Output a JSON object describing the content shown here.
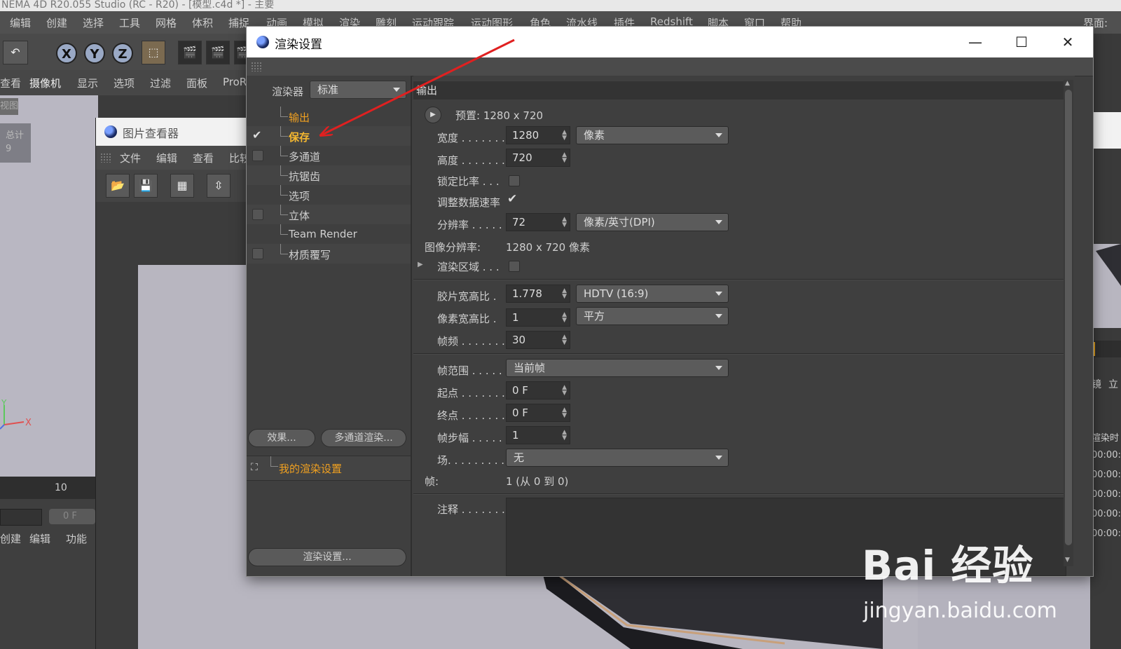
{
  "app": {
    "title": "NEMA 4D R20.055 Studio (RC - R20) - [模型.c4d *] - 主要",
    "menu": [
      "编辑",
      "创建",
      "选择",
      "工具",
      "网格",
      "体积",
      "捕捉",
      "动画",
      "模拟",
      "渲染",
      "雕刻",
      "运动跟踪",
      "运动图形",
      "角色",
      "流水线",
      "插件",
      "Redshift",
      "脚本",
      "窗口",
      "帮助"
    ],
    "interface_label": "界面:",
    "axis_buttons": [
      "X",
      "Y",
      "Z"
    ],
    "viewport_menu": [
      "查看",
      "摄像机",
      "显示",
      "选项",
      "过滤",
      "面板",
      "ProR"
    ],
    "view_tab": "视图",
    "total_label": "总计",
    "total_value": "9",
    "axis_y": "Y",
    "axis_x": "X",
    "timeline_tick": "10",
    "frame_field": "0 F",
    "bottom_menu": [
      "创建",
      "编辑",
      "功能"
    ]
  },
  "picture_viewer": {
    "title": "图片查看器",
    "menu": [
      "文件",
      "编辑",
      "查看",
      "比较"
    ]
  },
  "dialog": {
    "title": "渲染设置",
    "renderer_label": "渲染器",
    "renderer_value": "标准",
    "tree": [
      {
        "label": "输出",
        "checked": null,
        "style": "orange"
      },
      {
        "label": "保存",
        "checked": true,
        "style": "active"
      },
      {
        "label": "多通道",
        "checked": false,
        "style": "normal"
      },
      {
        "label": "抗锯齿",
        "checked": null,
        "style": "normal"
      },
      {
        "label": "选项",
        "checked": null,
        "style": "normal"
      },
      {
        "label": "立体",
        "checked": false,
        "style": "normal"
      },
      {
        "label": "Team Render",
        "checked": null,
        "style": "normal"
      },
      {
        "label": "材质覆写",
        "checked": false,
        "style": "normal"
      }
    ],
    "effects_button": "效果...",
    "multipass_button": "多通道渲染...",
    "preset_name": "我的渲染设置",
    "render_settings_button": "渲染设置...",
    "section_title": "输出",
    "preset_label": "预置: 1280 x 720",
    "width_label": "宽度 . . . . . . .",
    "width_value": "1280",
    "width_unit": "像素",
    "height_label": "高度 . . . . . . .",
    "height_value": "720",
    "lock_ratio_label": "锁定比率 . . .",
    "adjust_rate_label": "调整数据速率",
    "resolution_label": "分辨率 . . . . .",
    "resolution_value": "72",
    "resolution_unit": "像素/英寸(DPI)",
    "image_res_label": "图像分辨率:",
    "image_res_value": "1280 x 720 像素",
    "render_region_label": "渲染区域 . . .",
    "film_aspect_label": "胶片宽高比 .",
    "film_aspect_value": "1.778",
    "film_aspect_preset": "HDTV (16:9)",
    "pixel_aspect_label": "像素宽高比 .",
    "pixel_aspect_value": "1",
    "pixel_aspect_preset": "平方",
    "fps_label": "帧频 . . . . . . .",
    "fps_value": "30",
    "frame_range_label": "帧范围 . . . . .",
    "frame_range_value": "当前帧",
    "start_label": "起点 . . . . . . .",
    "start_value": "0 F",
    "end_label": "终点 . . . . . . .",
    "end_value": "0 F",
    "step_label": "帧步幅 . . . . .",
    "step_value": "1",
    "field_label": "场. . . . . . . . .",
    "field_value": "无",
    "frames_label": "帧:",
    "frames_value": "1 (从 0 到 0)",
    "notes_label": "注释 . . . . . . ."
  },
  "right_panel": {
    "labels": [
      "镜",
      "立"
    ],
    "times_header": "渲染时",
    "times": [
      "00:00:",
      "00:00:",
      "00:00:",
      "00:00:",
      "00:00:"
    ]
  },
  "watermark": {
    "brand": "Bai 经验",
    "url": "jingyan.baidu.com"
  },
  "colors": {
    "accent_orange": "#f0a020",
    "annotation_red": "#e02020"
  }
}
